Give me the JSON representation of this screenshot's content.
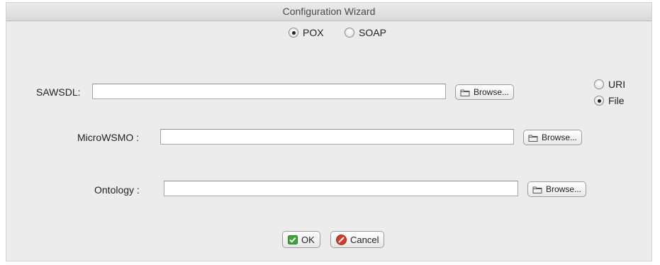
{
  "window": {
    "title": "Configuration Wizard"
  },
  "protocol": {
    "options": [
      {
        "label": "POX",
        "selected": true
      },
      {
        "label": "SOAP",
        "selected": false
      }
    ]
  },
  "source_type": {
    "options": [
      {
        "label": "URI",
        "selected": false
      },
      {
        "label": "File",
        "selected": true
      }
    ]
  },
  "fields": {
    "sawsdl": {
      "label": "SAWSDL:",
      "value": "",
      "browse_label": "Browse..."
    },
    "microwsmo": {
      "label": "MicroWSMO :",
      "value": "",
      "browse_label": "Browse..."
    },
    "ontology": {
      "label": "Ontology :",
      "value": "",
      "browse_label": "Browse..."
    }
  },
  "actions": {
    "ok_label": "OK",
    "cancel_label": "Cancel"
  },
  "icons": {
    "folder": "folder-icon",
    "ok": "checkmark-icon",
    "cancel": "cancel-icon"
  },
  "colors": {
    "window_bg": "#ececec",
    "ok_green": "#3aa63a",
    "cancel_red": "#d23a2a"
  }
}
